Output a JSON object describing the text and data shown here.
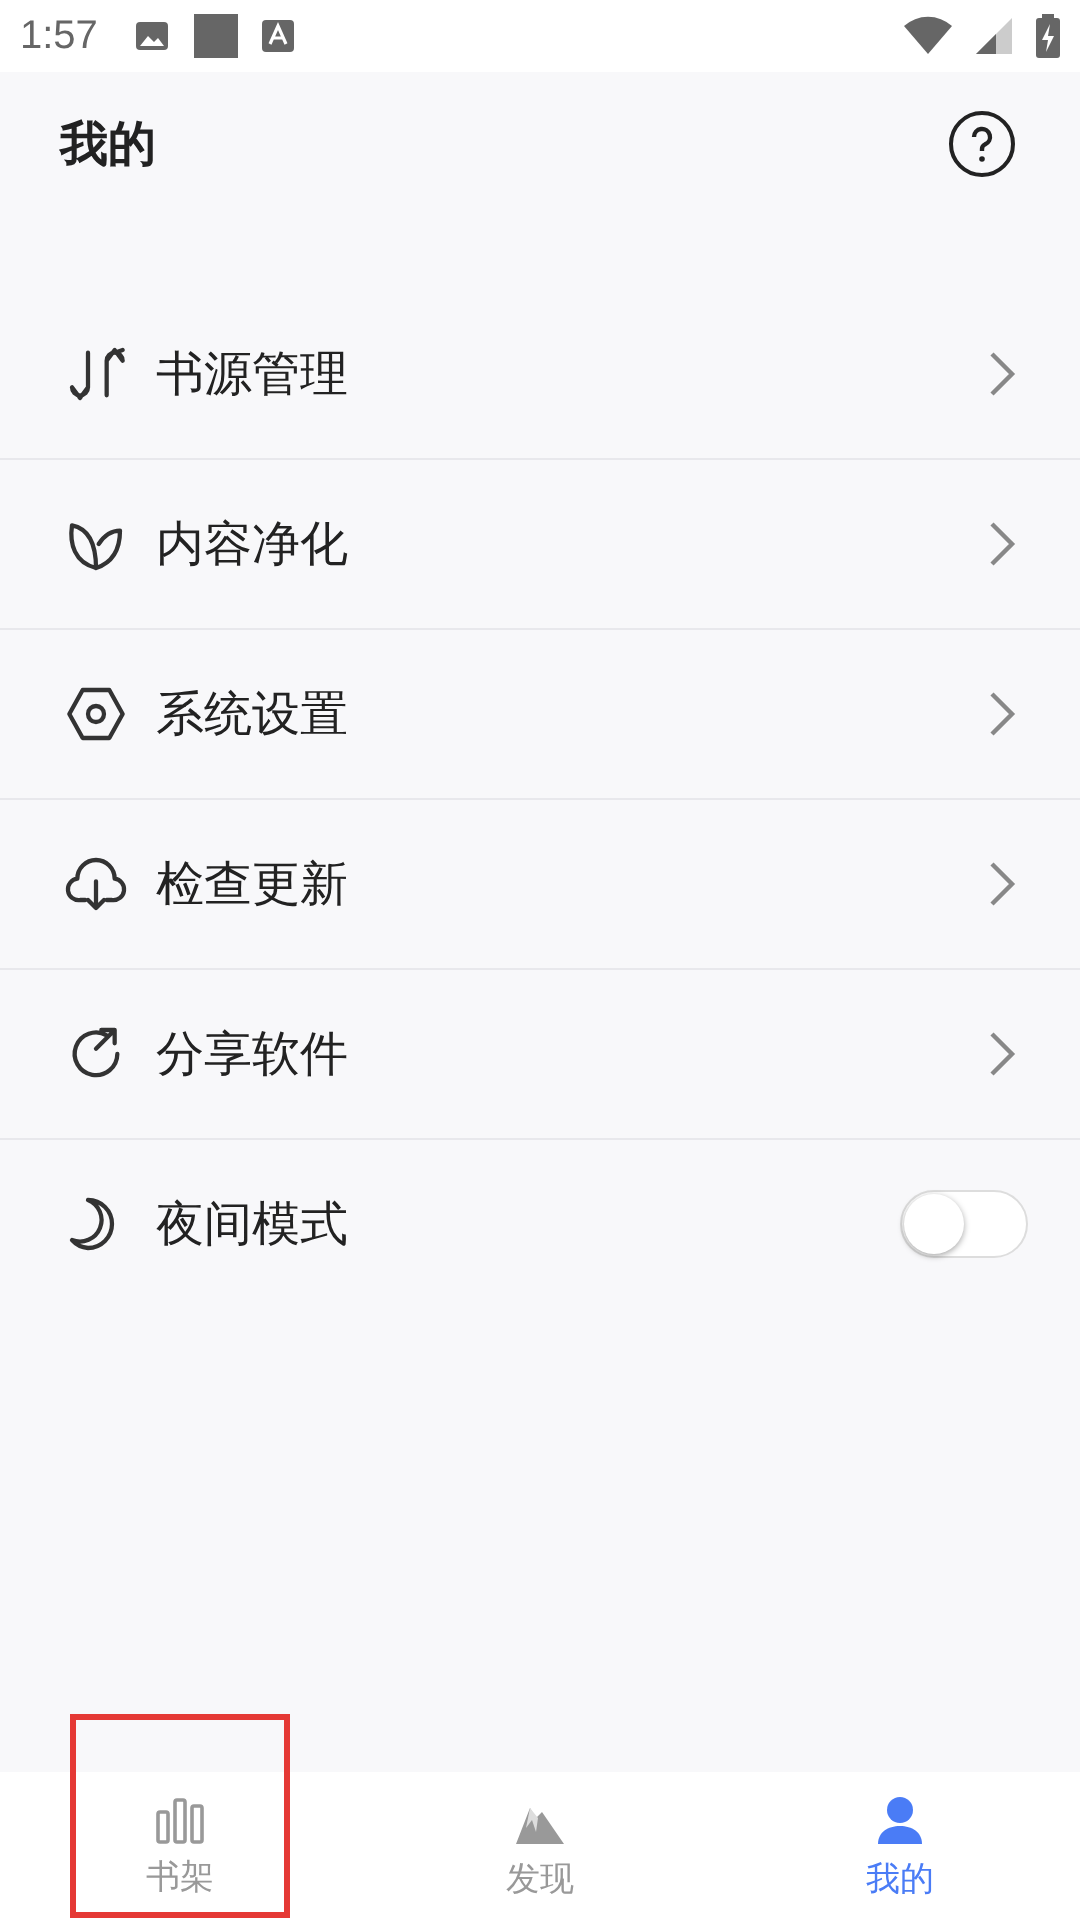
{
  "status_bar": {
    "time": "1:57"
  },
  "header": {
    "title": "我的"
  },
  "menu": [
    {
      "label": "书源管理",
      "kind": "link"
    },
    {
      "label": "内容净化",
      "kind": "link"
    },
    {
      "label": "系统设置",
      "kind": "link"
    },
    {
      "label": "检查更新",
      "kind": "link"
    },
    {
      "label": "分享软件",
      "kind": "link"
    },
    {
      "label": "夜间模式",
      "kind": "toggle",
      "on": false
    }
  ],
  "bottom_nav": [
    {
      "label": "书架",
      "selected": false,
      "highlighted": true
    },
    {
      "label": "发现",
      "selected": false,
      "highlighted": false
    },
    {
      "label": "我的",
      "selected": true,
      "highlighted": false
    }
  ]
}
